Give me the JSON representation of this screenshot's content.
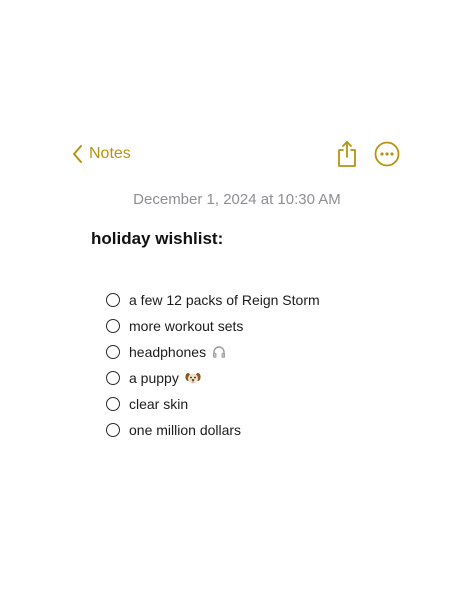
{
  "nav": {
    "back_label": "Notes",
    "back_icon": "chevron-left-icon",
    "share_icon": "share-icon",
    "more_icon": "more-options-icon",
    "accent_color": "#b8930f"
  },
  "note": {
    "date": "December 1, 2024 at 10:30 AM",
    "title": "holiday wishlist:",
    "items": [
      {
        "text": "a few 12 packs of Reign Storm",
        "checked": false
      },
      {
        "text": "more workout sets",
        "checked": false
      },
      {
        "text": "headphones",
        "checked": false,
        "icon": "headphones-icon"
      },
      {
        "text": "a puppy",
        "checked": false,
        "icon": "puppy-icon"
      },
      {
        "text": "clear skin",
        "checked": false
      },
      {
        "text": "one million dollars",
        "checked": false
      }
    ]
  }
}
